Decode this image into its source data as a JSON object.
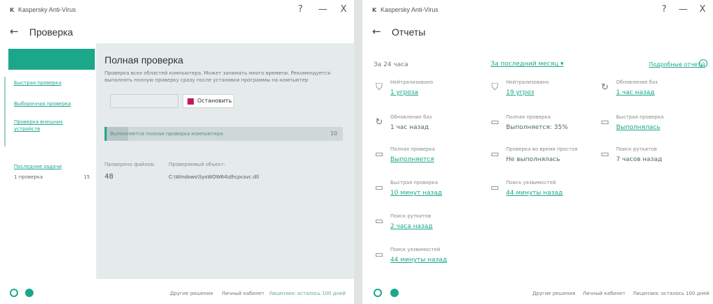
{
  "colors": {
    "accent": "#1aa78a",
    "stop": "#c2185b"
  },
  "window1": {
    "app_title": "Kaspersky Anti-Virus",
    "help_label": "?",
    "minimize_label": "—",
    "close_label": "X",
    "page_title": "Проверка",
    "sidebar": {
      "links": [
        "Быстрая проверка",
        "Выборочная проверка",
        "Проверка внешних устройств"
      ],
      "history_label": "Последние задачи",
      "history_item": "1 проверка",
      "history_count": "15"
    },
    "scan": {
      "title": "Полная проверка",
      "description": "Проверка всех областей компьютера. Может занимать много времени. Рекомендуется выполнять полную проверку сразу после установки программы на компьютер",
      "stop_label": "Остановить",
      "progress_text": "Выполняется полная проверка компьютера",
      "progress_percent_value": "10",
      "progress_fraction": 0.1,
      "files_label": "Проверено файлов:",
      "files_value": "48",
      "object_label": "Проверяемый объект:",
      "object_value": "C:\\Windows\\SysWOW64\\dhcpcsvc.dll"
    },
    "footer": {
      "links": [
        "Другие решения",
        "Личный кабинет",
        "Лицензия: осталось 100 дней"
      ]
    }
  },
  "window2": {
    "app_title": "Kaspersky Anti-Virus",
    "help_label": "?",
    "minimize_label": "—",
    "close_label": "X",
    "page_title": "Отчеты",
    "period_label": "За 24 часа",
    "period_select": "За последний месяц ▾",
    "details_link": "Подробные отчеты",
    "tiles": [
      {
        "label": "Нейтрализовано",
        "value": "1 угроза",
        "icon": "shield-icon",
        "link": true
      },
      {
        "label": "Нейтрализовано",
        "value": "19 угроз",
        "icon": "shield-icon",
        "link": true
      },
      {
        "label": "Обновление баз",
        "value": "1 час назад",
        "icon": "update-icon",
        "link": true
      },
      {
        "label": "Обновление баз",
        "value": "1 час назад",
        "icon": "update-icon",
        "link": false
      },
      {
        "label": "Полная проверка",
        "value": "Выполняется: 35%",
        "icon": "monitor-scan-icon",
        "link": false
      },
      {
        "label": "Быстрая проверка",
        "value": "Выполнялась",
        "icon": "monitor-scan-icon",
        "link": true
      },
      {
        "label": "Полная проверка",
        "value": "Выполняется",
        "icon": "monitor-scan-icon",
        "link": true
      },
      {
        "label": "Проверка во время простоя",
        "value": "Не выполнялась",
        "icon": "monitor-scan-icon",
        "link": false
      },
      {
        "label": "Поиск руткитов",
        "value": "7 часов назад",
        "icon": "monitor-scan-icon",
        "link": false
      },
      {
        "label": "Быстрая проверка",
        "value": "10 минут назад",
        "icon": "monitor-scan-icon",
        "link": true
      },
      {
        "label": "Поиск уязвимостей",
        "value": "44 минуты назад",
        "icon": "monitor-scan-icon",
        "link": true
      },
      {
        "label": "Поиск руткитов",
        "value": "2 часа назад",
        "icon": "monitor-scan-icon",
        "link": true
      },
      {
        "label": "Поиск уязвимостей",
        "value": "44 минуты назад",
        "icon": "monitor-scan-icon",
        "link": true
      }
    ],
    "footer": {
      "links": [
        "Другие решения",
        "Личный кабинет",
        "Лицензия: осталось 100 дней"
      ]
    }
  }
}
